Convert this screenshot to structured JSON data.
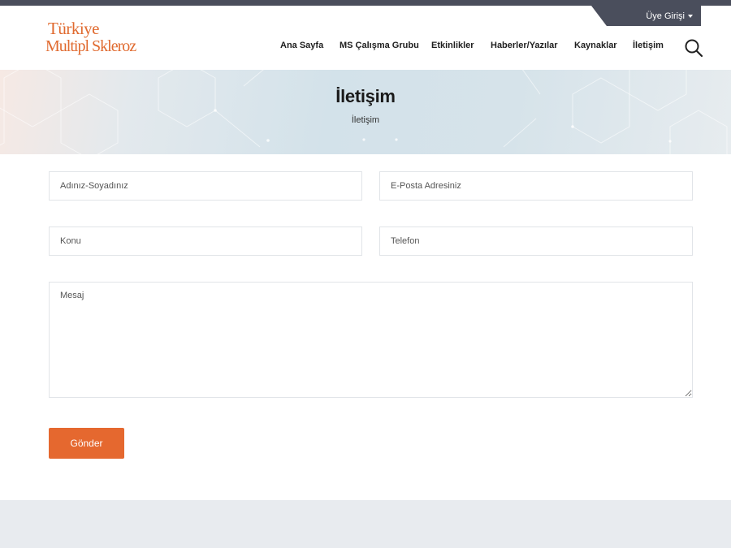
{
  "top_bar": {
    "member_login_label": "Üye Girişi"
  },
  "logo": {
    "line1": "Türkiye",
    "line2": "Multipl Skleroz"
  },
  "nav": {
    "items": [
      {
        "label": "Ana Sayfa"
      },
      {
        "label": "MS Çalışma Grubu"
      },
      {
        "label": "Etkinlikler"
      },
      {
        "label": "Haberler/Yazılar"
      },
      {
        "label": "Kaynaklar"
      },
      {
        "label": "İletişim"
      }
    ],
    "search_icon": "search-icon"
  },
  "hero": {
    "title": "İletişim",
    "breadcrumb": "İletişim"
  },
  "form": {
    "name_placeholder": "Adınız-Soyadınız",
    "email_placeholder": "E-Posta Adresiniz",
    "subject_placeholder": "Konu",
    "phone_placeholder": "Telefon",
    "message_placeholder": "Mesaj",
    "submit_label": "Gönder"
  },
  "colors": {
    "accent": "#e5682f",
    "dark_bar": "#4a4e5c",
    "footer": "#e8ebef"
  }
}
